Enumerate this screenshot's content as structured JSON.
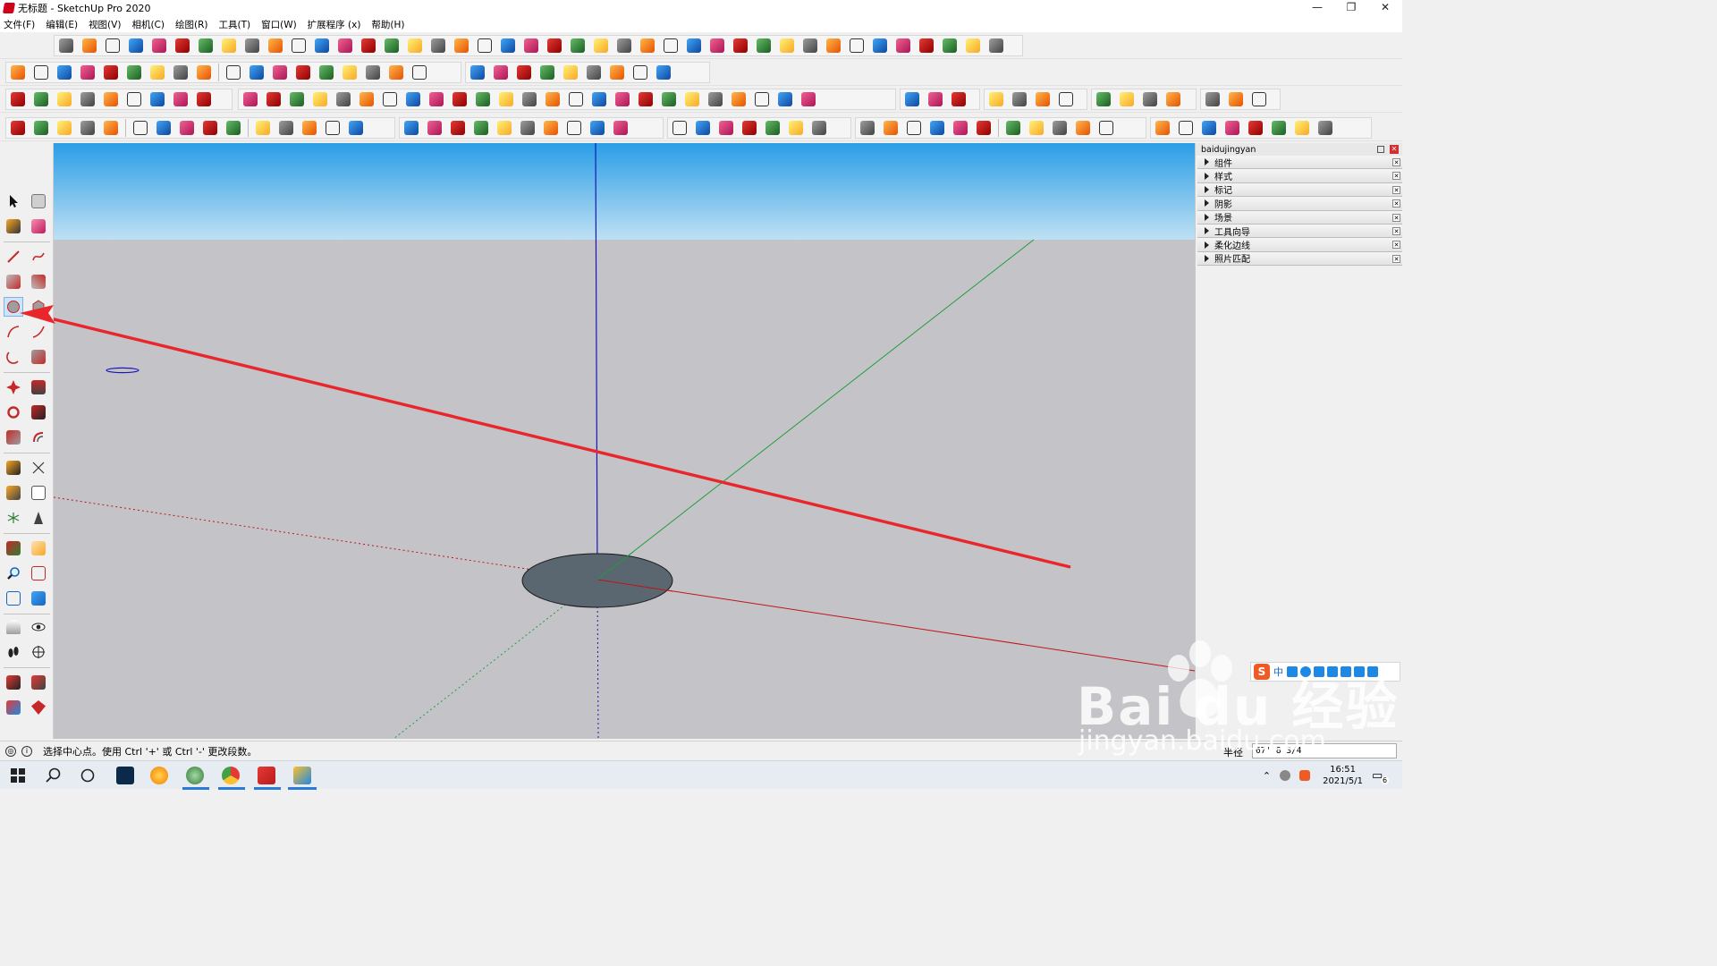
{
  "window": {
    "title": "无标题 - SketchUp Pro 2020",
    "controls": [
      "—",
      "❐",
      "✕"
    ]
  },
  "menu": [
    "文件(F)",
    "编辑(E)",
    "视图(V)",
    "相机(C)",
    "绘图(R)",
    "工具(T)",
    "窗口(W)",
    "扩展程序 (x)",
    "帮助(H)"
  ],
  "tray": {
    "title": "baidujingyan",
    "panels": [
      "组件",
      "样式",
      "标记",
      "阴影",
      "场景",
      "工具向导",
      "柔化边线",
      "照片匹配"
    ]
  },
  "ime": {
    "label": "中"
  },
  "watermark": {
    "main": "Bai du 经验",
    "sub": "jingyan.baidu.com"
  },
  "status": {
    "message": "选择中心点。使用 Ctrl '+' 或 Ctrl '-' 更改段数。",
    "vcb_label": "半径",
    "vcb_value": "67' 8 3/4"
  },
  "clock": {
    "time": "16:51",
    "date": "2021/5/1"
  },
  "notification_count": "6",
  "colors": {
    "sky_top": "#2a9ee6",
    "sky_bottom": "#bfe0f3",
    "ground": "#c4c4c8",
    "axis_red": "#c0141a",
    "axis_green": "#1f9e3a",
    "axis_blue": "#1818b8",
    "arrow": "#e8262c",
    "circle_fill": "#5a6670"
  }
}
